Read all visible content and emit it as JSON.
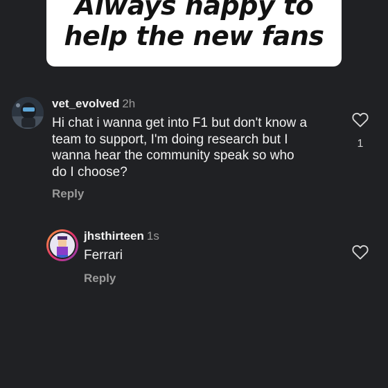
{
  "banner": {
    "line1": "Always happy to",
    "line2": "help the new fans"
  },
  "comments": [
    {
      "username": "vet_evolved",
      "time": "2h",
      "text_lines": [
        "Hi chat i wanna get into F1 but don't know a",
        "team to support, I'm doing research but I",
        "wanna hear the community speak so who",
        "do I choose?"
      ],
      "reply_label": "Reply",
      "like_count": "1"
    },
    {
      "username": "jhsthirteen",
      "time": "1s",
      "text": "Ferrari",
      "reply_label": "Reply"
    }
  ],
  "colors": {
    "background": "#202124",
    "text": "#f2f2f2",
    "muted": "#9a9a9a",
    "avatar_ring_gradient": [
      "#f9a23a",
      "#e2336b",
      "#8a3ab9"
    ]
  },
  "icons": [
    "heart-icon"
  ]
}
